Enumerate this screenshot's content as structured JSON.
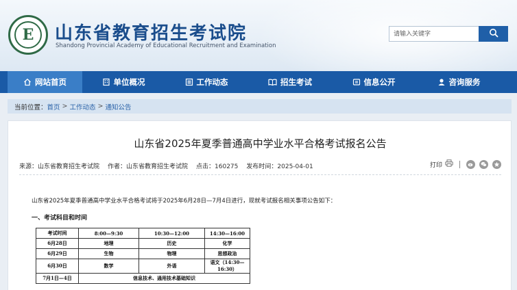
{
  "header": {
    "logo_letter": "E",
    "title": "山东省教育招生考试院",
    "subtitle": "Shandong Provincial Academy of Educational Recruitment and Examination"
  },
  "search": {
    "placeholder": "请输入关键字",
    "icon": "search-icon"
  },
  "nav": {
    "items": [
      {
        "label": "网站首页",
        "icon": "home-icon",
        "active": true
      },
      {
        "label": "单位概况",
        "icon": "building-icon"
      },
      {
        "label": "工作动态",
        "icon": "list-icon"
      },
      {
        "label": "招生考试",
        "icon": "book-icon"
      },
      {
        "label": "信息公开",
        "icon": "info-icon"
      },
      {
        "label": "咨询服务",
        "icon": "user-icon"
      }
    ]
  },
  "breadcrumb": {
    "prefix": "当前位置：",
    "items": [
      "首页",
      "工作动态",
      "通知公告"
    ],
    "separator": ">"
  },
  "article": {
    "title": "山东省2025年夏季普通高中学业水平合格考试报名公告",
    "meta": {
      "source": "来源：山东省教育招生考试院",
      "author": "作者：山东省教育招生考试院",
      "hits": "点击：160275",
      "published": "发布时间：2025-04-01"
    },
    "tools": {
      "print_label": "打印",
      "share_icons": [
        "weibo-icon",
        "wechat-icon",
        "star-icon"
      ]
    },
    "intro": "山东省2025年夏季普通高中学业水平合格考试将于2025年6月28日—7月4日进行，现就考试报名相关事项公告如下：",
    "section_heading": "一、考试科目和时间",
    "schedule": {
      "header": [
        "考试时间",
        "8:00—9:30",
        "10:30—12:00",
        "14:30—16:00"
      ],
      "rows": [
        [
          "6月28日",
          "地理",
          "历史",
          "化学"
        ],
        [
          "6月29日",
          "生物",
          "物理",
          "思想政治"
        ],
        [
          "6月30日",
          "数学",
          "外语",
          "语文（14:30—16:30）"
        ]
      ],
      "last_row": {
        "date": "7月1日—4日",
        "subject": "信息技术、通用技术基础知识"
      }
    }
  },
  "colors": {
    "nav": "#1a5aa6",
    "nav_active": "#3a7ec7",
    "title": "#1a4d8c",
    "link": "#2a62a8"
  }
}
